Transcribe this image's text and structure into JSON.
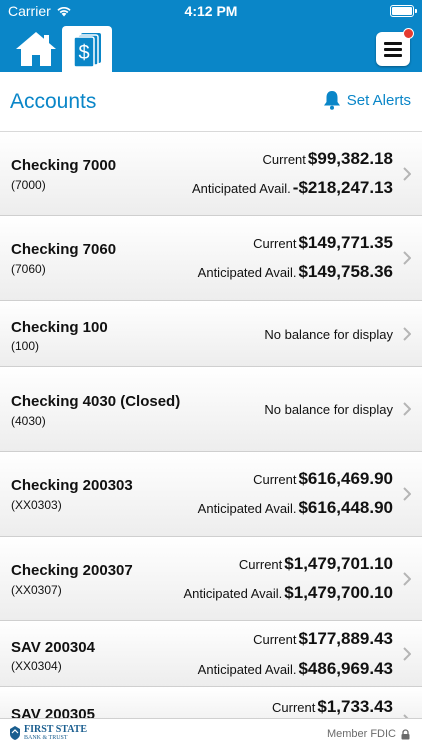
{
  "status_bar": {
    "carrier": "Carrier",
    "time": "4:12 PM"
  },
  "nav": {
    "home_icon": "home-icon",
    "accounts_icon": "dollar-card-icon",
    "menu_icon": "hamburger-menu-icon",
    "brand_color": "#0a86c8",
    "badge_color": "#e53b30"
  },
  "header": {
    "title": "Accounts",
    "alerts_label": "Set Alerts"
  },
  "accounts": [
    {
      "name": "Checking 7000",
      "number": "(7000)",
      "current_label": "Current",
      "current": "$99,382.18",
      "avail_label": "Anticipated Avail.",
      "avail": "-$218,247.13"
    },
    {
      "name": "Checking 7060",
      "number": "(7060)",
      "current_label": "Current",
      "current": "$149,771.35",
      "avail_label": "Anticipated Avail.",
      "avail": "$149,758.36"
    },
    {
      "name": "Checking 100",
      "number": "(100)",
      "no_balance": "No balance for display"
    },
    {
      "name": "Checking 4030 (Closed)",
      "number": "(4030)",
      "no_balance": "No balance for display"
    },
    {
      "name": "Checking 200303",
      "number": "(XX0303)",
      "current_label": "Current",
      "current": "$616,469.90",
      "avail_label": "Anticipated Avail.",
      "avail": "$616,448.90"
    },
    {
      "name": "Checking 200307",
      "number": "(XX0307)",
      "current_label": "Current",
      "current": "$1,479,701.10",
      "avail_label": "Anticipated Avail.",
      "avail": "$1,479,700.10"
    },
    {
      "name": "SAV 200304",
      "number": "(XX0304)",
      "current_label": "Current",
      "current": "$177,889.43",
      "avail_label": "Anticipated Avail.",
      "avail": "$486,969.43"
    },
    {
      "name": "SAV 200305",
      "current_label": "Current",
      "current": "$1,733.43"
    }
  ],
  "footer": {
    "bank_name": "FIRST STATE",
    "bank_sub": "BANK & TRUST",
    "fdic": "Member FDIC",
    "lock_icon": "lock-icon"
  }
}
